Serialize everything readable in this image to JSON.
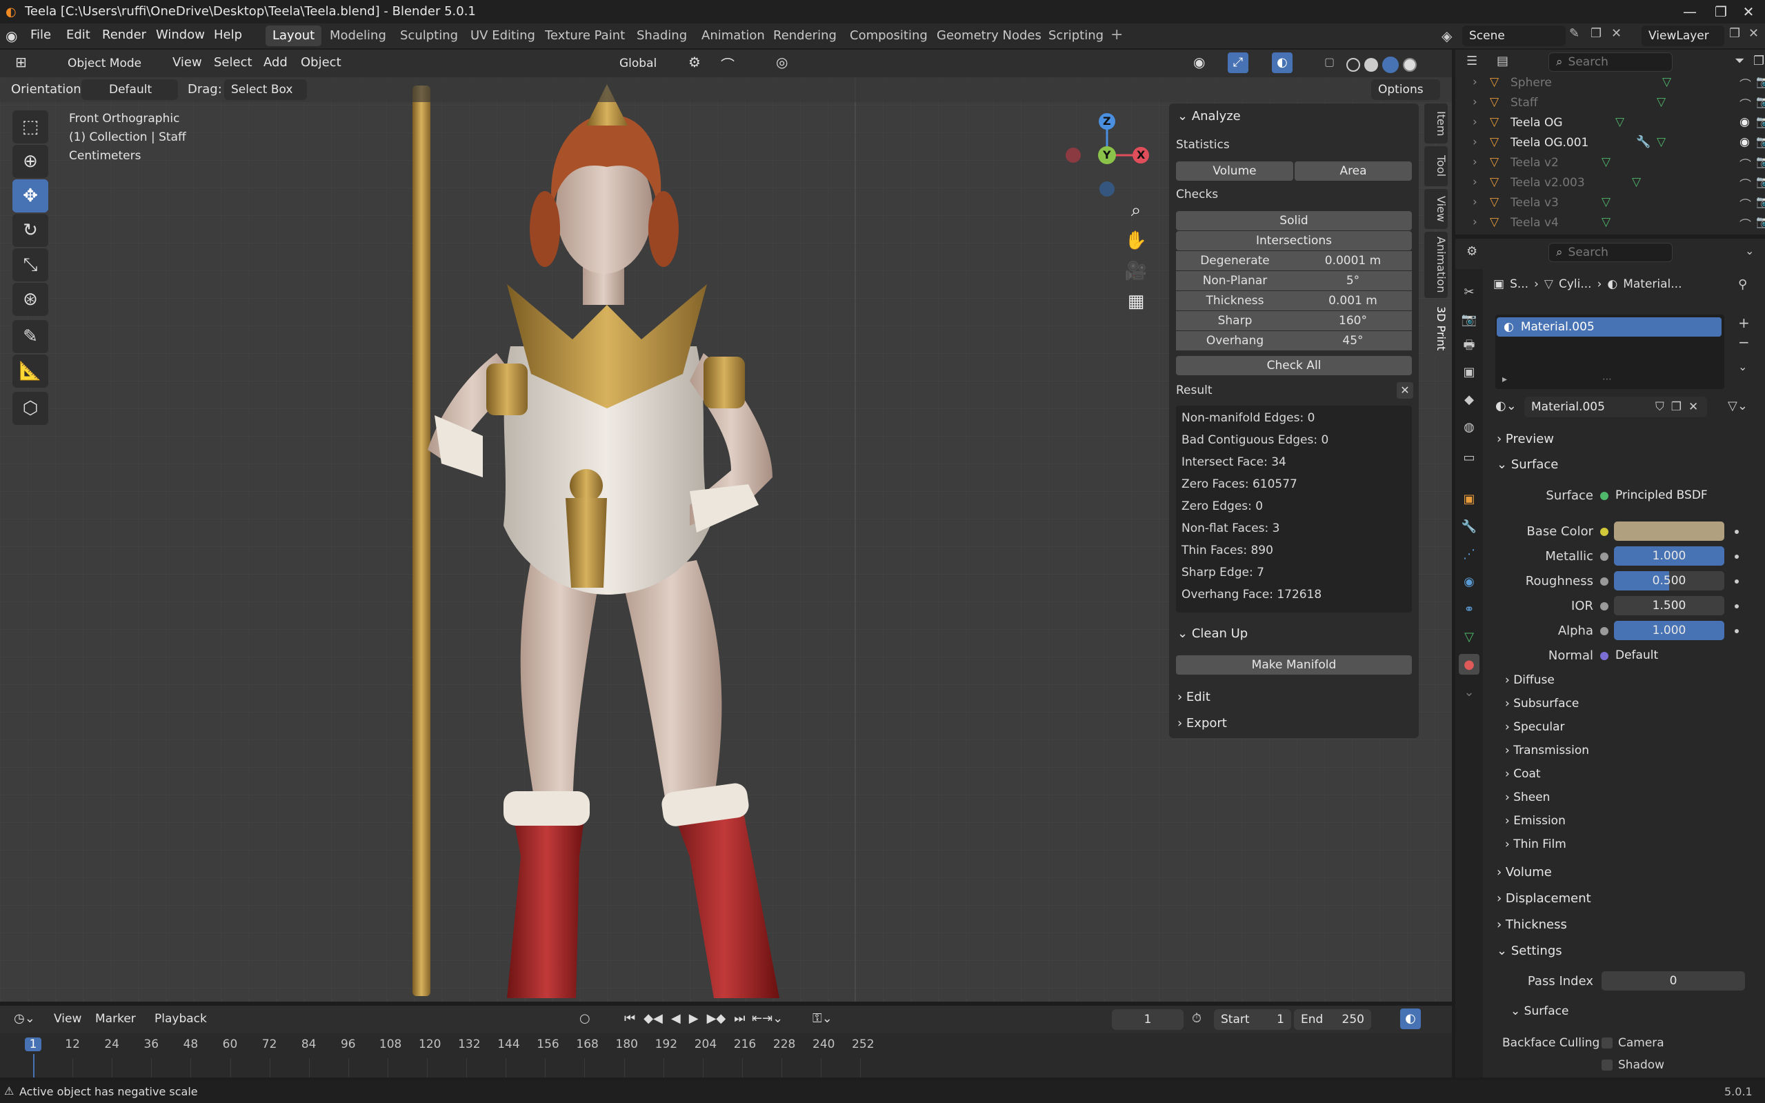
{
  "window": {
    "title": "Teela [C:\\Users\\ruffi\\OneDrive\\Desktop\\Teela\\Teela.blend] - Blender 5.0.1"
  },
  "menubar": {
    "menus": [
      "File",
      "Edit",
      "Render",
      "Window",
      "Help"
    ],
    "workspaces": [
      "Layout",
      "Modeling",
      "Sculpting",
      "UV Editing",
      "Texture Paint",
      "Shading",
      "Animation",
      "Rendering",
      "Compositing",
      "Geometry Nodes",
      "Scripting"
    ],
    "active_workspace": "Layout",
    "scene": "Scene",
    "view_layer": "ViewLayer"
  },
  "viewport_header": {
    "mode": "Object Mode",
    "menus": [
      "View",
      "Select",
      "Add",
      "Object"
    ],
    "transform_orientation": "Global",
    "orientation_label": "Orientation:",
    "orientation_value": "Default",
    "drag_label": "Drag:",
    "drag_value": "Select Box",
    "options": "Options"
  },
  "viewport_overlay": {
    "view_name": "Front Orthographic",
    "collection": "(1) Collection | Staff",
    "units": "Centimeters",
    "gizmo_axes": {
      "z": "Z",
      "y": "Y",
      "x": "X"
    }
  },
  "npanel": {
    "tabs": [
      "Item",
      "Tool",
      "View",
      "Animation",
      "3D Print"
    ],
    "active_tab": "3D Print",
    "analyze": {
      "title": "Analyze",
      "statistics": "Statistics",
      "volume_btn": "Volume",
      "area_btn": "Area",
      "checks": "Checks",
      "solid": "Solid",
      "intersections": "Intersections",
      "rows": [
        {
          "label": "Degenerate",
          "value": "0.0001 m"
        },
        {
          "label": "Non-Planar",
          "value": "5°"
        },
        {
          "label": "Thickness",
          "value": "0.001 m"
        },
        {
          "label": "Sharp",
          "value": "160°"
        },
        {
          "label": "Overhang",
          "value": "45°"
        }
      ],
      "check_all": "Check All"
    },
    "result": {
      "title": "Result",
      "lines": [
        "Non-manifold Edges: 0",
        "Bad Contiguous Edges: 0",
        "Intersect Face: 34",
        "Zero Faces: 610577",
        "Zero Edges: 0",
        "Non-flat Faces: 3",
        "Thin Faces: 890",
        "Sharp Edge: 7",
        "Overhang Face: 172618"
      ]
    },
    "cleanup": {
      "title": "Clean Up",
      "make_manifold": "Make Manifold"
    },
    "edit": "Edit",
    "export": "Export"
  },
  "outliner": {
    "search_placeholder": "Search",
    "items": [
      {
        "name": "Sphere",
        "dim": true
      },
      {
        "name": "Staff",
        "dim": true
      },
      {
        "name": "Teela OG",
        "dim": false
      },
      {
        "name": "Teela OG.001",
        "dim": false
      },
      {
        "name": "Teela v2",
        "dim": true
      },
      {
        "name": "Teela v2.003",
        "dim": true
      },
      {
        "name": "Teela v3",
        "dim": true
      },
      {
        "name": "Teela v4",
        "dim": true
      }
    ]
  },
  "properties": {
    "search_placeholder": "Search",
    "breadcrumb": [
      "S...",
      "Cyli...",
      "Material..."
    ],
    "slot": "Material.005",
    "material_name": "Material.005",
    "preview": "Preview",
    "surface_section": "Surface",
    "surface_label": "Surface",
    "surface_shader": "Principled BSDF",
    "params": [
      {
        "label": "Base Color",
        "value": "",
        "color": "#b0a080"
      },
      {
        "label": "Metallic",
        "value": "1.000",
        "fill": 1.0
      },
      {
        "label": "Roughness",
        "value": "0.500",
        "fill": 0.5
      },
      {
        "label": "IOR",
        "value": "1.500",
        "fill": 0.0
      },
      {
        "label": "Alpha",
        "value": "1.000",
        "fill": 1.0
      },
      {
        "label": "Normal",
        "value": "Default",
        "fill": 0.0
      }
    ],
    "subsections": [
      "Diffuse",
      "Subsurface",
      "Specular",
      "Transmission",
      "Coat",
      "Sheen",
      "Emission",
      "Thin Film"
    ],
    "sections": [
      "Volume",
      "Displacement",
      "Thickness"
    ],
    "settings": "Settings",
    "pass_index_label": "Pass Index",
    "pass_index": "0",
    "settings_surface": "Surface",
    "backface_label": "Backface Culling",
    "camera": "Camera",
    "shadow": "Shadow"
  },
  "timeline": {
    "menus": [
      "View",
      "Marker",
      "Playback"
    ],
    "current_frame": "1",
    "start_label": "Start",
    "start": "1",
    "end_label": "End",
    "end": "250",
    "ruler": [
      "1",
      "12",
      "24",
      "36",
      "48",
      "60",
      "72",
      "84",
      "96",
      "108",
      "120",
      "132",
      "144",
      "156",
      "168",
      "180",
      "192",
      "204",
      "216",
      "228",
      "240",
      "252"
    ]
  },
  "status": {
    "message": "Active object has negative scale",
    "version": "5.0.1"
  },
  "colors": {
    "accent": "#4772b3",
    "x_axis": "#e04e5b",
    "y_axis": "#8bc34a",
    "z_axis": "#4a8fe0"
  }
}
